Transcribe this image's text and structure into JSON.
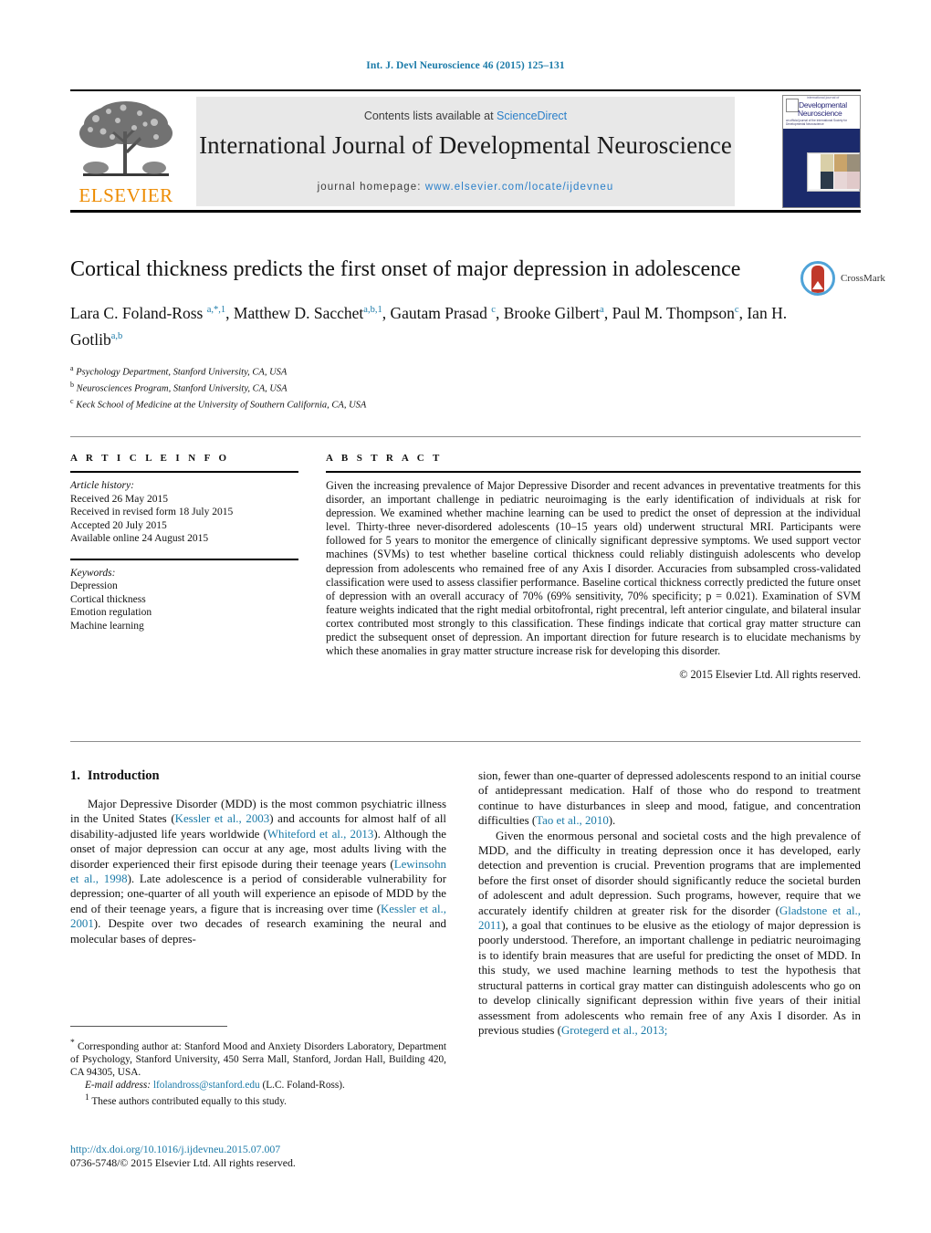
{
  "running_head": "Int. J. Devl Neuroscience 46 (2015) 125–131",
  "masthead": {
    "contents_prefix": "Contents lists available at ",
    "sciencedirect": "ScienceDirect",
    "journal_title": "International Journal of Developmental Neuroscience",
    "homepage_prefix": "journal homepage: ",
    "homepage_url": "www.elsevier.com/locate/ijdevneu",
    "publisher": "ELSEVIER",
    "cover": {
      "line0": "international journal of",
      "line1": "Developmental",
      "line2": "Neuroscience",
      "sub": "an official journal of the International Society for Developmental Neuroscience"
    }
  },
  "article": {
    "title": "Cortical thickness predicts the first onset of major depression in adolescence",
    "authors_html": "Lara C. Foland-Ross <sup>a,*,1</sup>, Matthew D. Sacchet<sup>a,b,1</sup>, Gautam Prasad <sup>c</sup>, Brooke Gilbert<sup>a</sup>, Paul M. Thompson<sup>c</sup>, Ian H. Gotlib<sup>a,b</sup>",
    "affiliations": [
      {
        "mark": "a",
        "text": "Psychology Department, Stanford University, CA, USA"
      },
      {
        "mark": "b",
        "text": "Neurosciences Program, Stanford University, CA, USA"
      },
      {
        "mark": "c",
        "text": "Keck School of Medicine at the University of Southern California, CA, USA"
      }
    ],
    "crossmark_label": "CrossMark"
  },
  "article_info": {
    "heading": "A R T I C L E   I N F O",
    "history_label": "Article history:",
    "history": [
      "Received 26 May 2015",
      "Received in revised form 18 July 2015",
      "Accepted 20 July 2015",
      "Available online 24 August 2015"
    ],
    "keywords_label": "Keywords:",
    "keywords": [
      "Depression",
      "Cortical thickness",
      "Emotion regulation",
      "Machine learning"
    ]
  },
  "abstract": {
    "heading": "A B S T R A C T",
    "text": "Given the increasing prevalence of Major Depressive Disorder and recent advances in preventative treatments for this disorder, an important challenge in pediatric neuroimaging is the early identification of individuals at risk for depression. We examined whether machine learning can be used to predict the onset of depression at the individual level. Thirty-three never-disordered adolescents (10–15 years old) underwent structural MRI. Participants were followed for 5 years to monitor the emergence of clinically significant depressive symptoms. We used support vector machines (SVMs) to test whether baseline cortical thickness could reliably distinguish adolescents who develop depression from adolescents who remained free of any Axis I disorder. Accuracies from subsampled cross-validated classification were used to assess classifier performance. Baseline cortical thickness correctly predicted the future onset of depression with an overall accuracy of 70% (69% sensitivity, 70% specificity; p = 0.021). Examination of SVM feature weights indicated that the right medial orbitofrontal, right precentral, left anterior cingulate, and bilateral insular cortex contributed most strongly to this classification. These findings indicate that cortical gray matter structure can predict the subsequent onset of depression. An important direction for future research is to elucidate mechanisms by which these anomalies in gray matter structure increase risk for developing this disorder.",
    "copyright": "© 2015 Elsevier Ltd. All rights reserved."
  },
  "body": {
    "section_number": "1.",
    "section_title": "Introduction",
    "left_paragraph_1_parts": [
      {
        "t": "Major Depressive Disorder (MDD) is the most common psychiatric illness in the United States ("
      },
      {
        "t": "Kessler et al., 2003",
        "ref": true
      },
      {
        "t": ") and accounts for almost half of all disability-adjusted life years worldwide ("
      },
      {
        "t": "Whiteford et al., 2013",
        "ref": true
      },
      {
        "t": "). Although the onset of major depression can occur at any age, most adults living with the disorder experienced their first episode during their teenage years ("
      },
      {
        "t": "Lewinsohn et al., 1998",
        "ref": true
      },
      {
        "t": "). Late adolescence is a period of considerable vulnerability for depression; one-quarter of all youth will experience an episode of MDD by the end of their teenage years, a figure that is increasing over time ("
      },
      {
        "t": "Kessler et al., 2001",
        "ref": true
      },
      {
        "t": "). Despite over two decades of research examining the neural and molecular bases of depres-"
      }
    ],
    "right_paragraph_1_parts": [
      {
        "t": "sion, fewer than one-quarter of depressed adolescents respond to an initial course of antidepressant medication. Half of those who do respond to treatment continue to have disturbances in sleep and mood, fatigue, and concentration difficulties ("
      },
      {
        "t": "Tao et al., 2010",
        "ref": true
      },
      {
        "t": ")."
      }
    ],
    "right_paragraph_2_parts": [
      {
        "t": "Given the enormous personal and societal costs and the high prevalence of MDD, and the difficulty in treating depression once it has developed, early detection and prevention is crucial. Prevention programs that are implemented before the first onset of disorder should significantly reduce the societal burden of adolescent and adult depression. Such programs, however, require that we accurately identify children at greater risk for the disorder ("
      },
      {
        "t": "Gladstone et al., 2011",
        "ref": true
      },
      {
        "t": "), a goal that continues to be elusive as the etiology of major depression is poorly understood. Therefore, an important challenge in pediatric neuroimaging is to identify brain measures that are useful for predicting the onset of MDD. In this study, we used machine learning methods to test the hypothesis that structural patterns in cortical gray matter can distinguish adolescents who go on to develop clinically significant depression within five years of their initial assessment from adolescents who remain free of any Axis I disorder. As in previous studies ("
      },
      {
        "t": "Grotegerd et al., 2013;",
        "ref": true
      }
    ]
  },
  "footnotes": {
    "corresponding": "Corresponding author at: Stanford Mood and Anxiety Disorders Laboratory, Department of Psychology, Stanford University, 450 Serra Mall, Stanford, Jordan Hall, Building 420, CA 94305, USA.",
    "corresponding_mark": "*",
    "email_label": "E-mail address:",
    "email": "lfolandross@stanford.edu",
    "email_suffix": "(L.C. Foland-Ross).",
    "equal_mark": "1",
    "equal_contribution": "These authors contributed equally to this study.",
    "doi": "http://dx.doi.org/10.1016/j.ijdevneu.2015.07.007",
    "issn": "0736-5748/© 2015 Elsevier Ltd. All rights reserved."
  },
  "colors": {
    "link": "#1a7aa8",
    "sciencedirect": "#2a7fc9",
    "elsevier_orange": "#ED8B00",
    "cover_navy": "#1b2a6b"
  }
}
